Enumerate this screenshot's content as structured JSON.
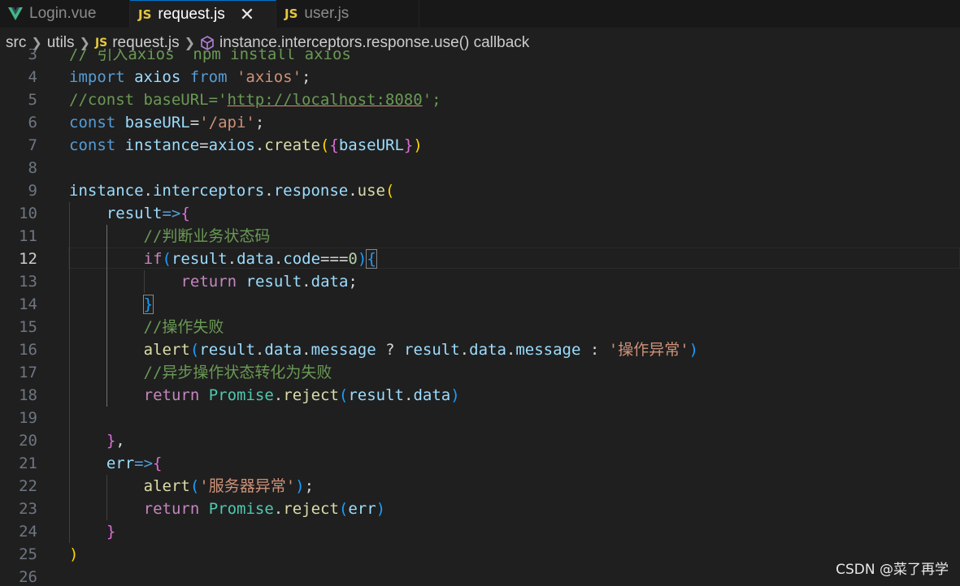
{
  "tabs": [
    {
      "name": "Login.vue",
      "icon": "vue-icon",
      "active": false
    },
    {
      "name": "request.js",
      "icon": "js-icon",
      "active": true
    },
    {
      "name": "user.js",
      "icon": "js-icon",
      "active": false
    }
  ],
  "js_icon_label": "JS",
  "breadcrumb": {
    "items": [
      "src",
      "utils",
      "request.js",
      "instance.interceptors.response.use() callback"
    ]
  },
  "editor": {
    "current_line": 12,
    "lines": [
      {
        "n": "3",
        "text": "// 引入axios  npm install axios"
      },
      {
        "n": "4",
        "text": "import axios from 'axios';"
      },
      {
        "n": "5",
        "text": "//const baseURL='http://localhost:8080';"
      },
      {
        "n": "6",
        "text": "const baseURL='/api';"
      },
      {
        "n": "7",
        "text": "const instance=axios.create({baseURL})"
      },
      {
        "n": "8",
        "text": ""
      },
      {
        "n": "9",
        "text": "instance.interceptors.response.use("
      },
      {
        "n": "10",
        "text": "    result=>{"
      },
      {
        "n": "11",
        "text": "        //判断业务状态码"
      },
      {
        "n": "12",
        "text": "        if(result.data.code===0){"
      },
      {
        "n": "13",
        "text": "            return result.data;"
      },
      {
        "n": "14",
        "text": "        }"
      },
      {
        "n": "15",
        "text": "        //操作失败"
      },
      {
        "n": "16",
        "text": "        alert(result.data.message ? result.data.message : '操作异常')"
      },
      {
        "n": "17",
        "text": "        //异步操作状态转化为失败"
      },
      {
        "n": "18",
        "text": "        return Promise.reject(result.data)"
      },
      {
        "n": "19",
        "text": ""
      },
      {
        "n": "20",
        "text": "    },"
      },
      {
        "n": "21",
        "text": "    err=>{"
      },
      {
        "n": "22",
        "text": "        alert('服务器异常');"
      },
      {
        "n": "23",
        "text": "        return Promise.reject(err)"
      },
      {
        "n": "24",
        "text": "    }"
      },
      {
        "n": "25",
        "text": ")"
      },
      {
        "n": "26",
        "text": ""
      }
    ]
  },
  "watermark": "CSDN @菜了再学",
  "colors": {
    "background": "#1f1f1f",
    "keyword": "#569cd6",
    "control": "#c586c0",
    "variable": "#9cdcfe",
    "function": "#dcdcaa",
    "string": "#ce9178",
    "comment": "#6a9955",
    "number": "#b5cea8",
    "class": "#4ec9b0"
  }
}
